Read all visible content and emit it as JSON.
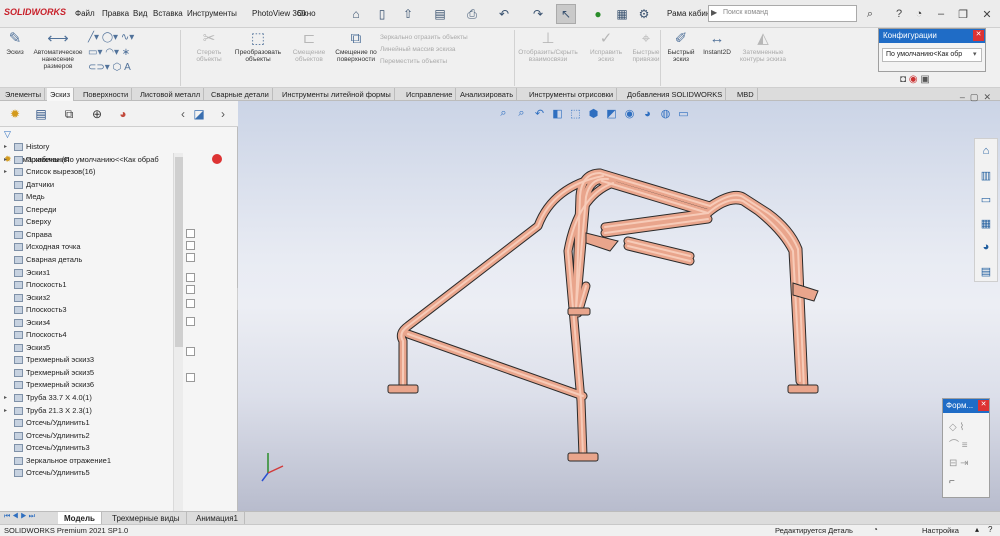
{
  "app": {
    "logo_text": "SOLIDWORKS"
  },
  "menu": [
    "Файл",
    "Правка",
    "Вид",
    "Вставка",
    "Инструменты",
    "PhotoView 360",
    "Окно"
  ],
  "document_title": "Рама кабин...",
  "search": {
    "placeholder": "Поиск команд"
  },
  "ribbon": {
    "buttons": [
      {
        "label": "Эскиз",
        "icon": "sketch-icon",
        "dim": false
      },
      {
        "label": "Автоматическое нанесение размеров",
        "icon": "smart-dimension-icon",
        "dim": false
      },
      {
        "label": "Стереть объекты",
        "icon": "trim-icon",
        "dim": true
      },
      {
        "label": "Преобразовать объекты",
        "icon": "convert-icon",
        "dim": false
      },
      {
        "label": "Смещение объектов",
        "icon": "offset-icon",
        "dim": true
      },
      {
        "label": "Смещение по поверхности",
        "icon": "offset-surface-icon",
        "dim": false
      },
      {
        "label": "Отобразить/Скрыть взаимосвязи",
        "icon": "relations-icon",
        "dim": true
      },
      {
        "label": "Исправить эскиз",
        "icon": "repair-sketch-icon",
        "dim": true
      },
      {
        "label": "Быстрые привязки",
        "icon": "snap-icon",
        "dim": true
      },
      {
        "label": "Быстрый эскиз",
        "icon": "rapid-sketch-icon",
        "dim": false
      },
      {
        "label": "Instant2D",
        "icon": "instant2d-icon",
        "dim": false
      },
      {
        "label": "Затемненные контуры эскиза",
        "icon": "shaded-contour-icon",
        "dim": true
      }
    ],
    "small_items": [
      "Зеркально отразить объекты",
      "Линейный массив эскиза",
      "Переместить объекты"
    ]
  },
  "tabs": [
    {
      "label": "Элементы",
      "active": false
    },
    {
      "label": "Эскиз",
      "active": true
    },
    {
      "label": "Поверхности",
      "active": false
    },
    {
      "label": "Листовой металл",
      "active": false
    },
    {
      "label": "Сварные детали",
      "active": false
    },
    {
      "label": "Инструменты литейной формы",
      "active": false
    },
    {
      "label": "Исправление",
      "active": false
    },
    {
      "label": "Анализировать",
      "active": false
    },
    {
      "label": "Инструменты отрисовки",
      "active": false
    },
    {
      "label": "Добавления SOLIDWORKS",
      "active": false
    },
    {
      "label": "MBD",
      "active": false
    }
  ],
  "tree": {
    "root": "Рама кабины  (По умолчанию<<Как обраб",
    "items": [
      {
        "label": "History",
        "arrow": true
      },
      {
        "label": "Примечания",
        "arrow": true
      },
      {
        "label": "Список вырезов(16)",
        "arrow": true
      },
      {
        "label": "Датчики",
        "arrow": false
      },
      {
        "label": "Медь",
        "arrow": false
      },
      {
        "label": "Спереди",
        "arrow": false
      },
      {
        "label": "Сверху",
        "arrow": false
      },
      {
        "label": "Справа",
        "arrow": false
      },
      {
        "label": "Исходная точка",
        "arrow": false
      },
      {
        "label": "Сварная деталь",
        "arrow": false
      },
      {
        "label": "Эскиз1",
        "arrow": false
      },
      {
        "label": "Плоскость1",
        "arrow": false
      },
      {
        "label": "Эскиз2",
        "arrow": false
      },
      {
        "label": "Плоскость3",
        "arrow": false
      },
      {
        "label": "Эскиз4",
        "arrow": false
      },
      {
        "label": "Плоскость4",
        "arrow": false
      },
      {
        "label": "Эскиз5",
        "arrow": false
      },
      {
        "label": "Трехмерный эскиз3",
        "arrow": false
      },
      {
        "label": "Трехмерный эскиз5",
        "arrow": false
      },
      {
        "label": "Трехмерный эскиз6",
        "arrow": false
      },
      {
        "label": "Труба 33.7 X 4.0(1)",
        "arrow": true
      },
      {
        "label": "Труба 21.3 X 2.3(1)",
        "arrow": true
      },
      {
        "label": "Отсечь/Удлинить1",
        "arrow": false
      },
      {
        "label": "Отсечь/Удлинить2",
        "arrow": false
      },
      {
        "label": "Отсечь/Удлинить3",
        "arrow": false
      },
      {
        "label": "Зеркальное отражение1",
        "arrow": false
      },
      {
        "label": "Отсечь/Удлинить5",
        "arrow": false
      }
    ]
  },
  "config_panel": {
    "title": "Конфигурации",
    "value": "По умолчанию<Как обр"
  },
  "form_panel": {
    "title": "Форм..."
  },
  "bottom_tabs": [
    {
      "label": "Модель",
      "active": true
    },
    {
      "label": "Трехмерные виды",
      "active": false
    },
    {
      "label": "Анимация1",
      "active": false
    }
  ],
  "status": {
    "left": "SOLIDWORKS Premium 2021 SP1.0",
    "mode": "Редактируется Деталь",
    "right": "Настройка"
  },
  "colors": {
    "tube": "#e9a58c",
    "tube_edge": "#2a2a2a",
    "accent": "#1f6cc6"
  }
}
